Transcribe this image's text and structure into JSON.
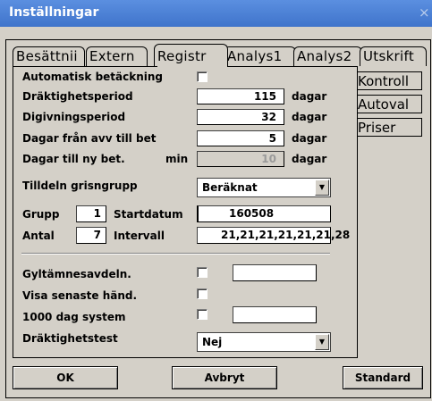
{
  "window": {
    "title": "Inställningar",
    "close_glyph": "×"
  },
  "tabs": [
    {
      "label": "Besättning",
      "display": "Besättnii"
    },
    {
      "label": "Extern",
      "display": "Extern"
    },
    {
      "label": "Registr",
      "display": "Registr",
      "active": true
    },
    {
      "label": "Analys1",
      "display": "Analys1"
    },
    {
      "label": "Analys2",
      "display": "Analys2"
    },
    {
      "label": "Utskrift",
      "display": "Utskrift"
    }
  ],
  "side_buttons": [
    "Kontroll",
    "Autoval",
    "Priser"
  ],
  "form": {
    "auto_cover_label": "Automatisk betäckning",
    "rows": [
      {
        "label": "Dräktighetsperiod",
        "value": "115",
        "unit": "dagar"
      },
      {
        "label": "Digivningsperiod",
        "value": "32",
        "unit": "dagar"
      },
      {
        "label": "Dagar från avv till bet",
        "value": "5",
        "unit": "dagar"
      },
      {
        "label": "Dagar till ny bet.",
        "suffix": "min",
        "value": "10",
        "unit": "dagar"
      }
    ],
    "group_alloc_label": "Tilldeln grisngrupp",
    "group_alloc_value": "Beräknat",
    "group_label": "Grupp",
    "group_value": "1",
    "start_date_label": "Startdatum",
    "start_date_value": "160508",
    "count_label": "Antal",
    "count_value": "7",
    "interval_label": "Intervall",
    "interval_value": "21,21,21,21,21,21,28",
    "yield_label": "Gyltämnesavdeln.",
    "latest_event_label": "Visa senaste händ.",
    "day_system_label": "1000 dag system",
    "preg_test_label": "Dräktighetstest",
    "preg_test_value": "Nej"
  },
  "buttons": {
    "ok": "OK",
    "cancel": "Avbryt",
    "standard": "Standard"
  },
  "icons": {
    "dropdown": "▼"
  }
}
